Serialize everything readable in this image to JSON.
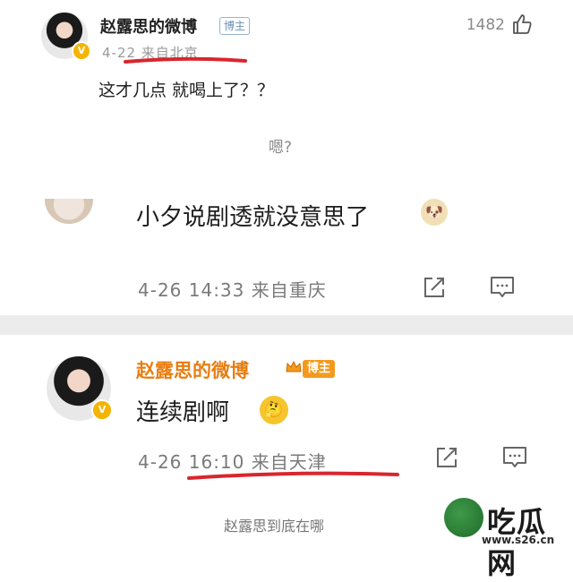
{
  "post1": {
    "author": "赵露思的微博",
    "author_tag": "博主",
    "meta": "4-22  来自北京",
    "like_count": "1482",
    "text": "这才几点 就喝上了？？"
  },
  "hmm_text": "嗯?",
  "post2": {
    "text": "小夕说剧透就没意思了",
    "meta": "4-26 14:33 来自重庆"
  },
  "post3": {
    "author": "赵露思的微博",
    "author_tag": "博主",
    "text": "连续剧啊",
    "meta": "4-26 16:10 来自天津"
  },
  "footer_text": "赵露思到底在哪",
  "watermark": {
    "name": "吃瓜网",
    "url": "www.s26.cn"
  },
  "colors": {
    "underline": "#d9262e",
    "gold_name": "#e87d10",
    "tag_orange": "#f39a1e"
  },
  "icons": [
    "thumbs-up-icon",
    "share-icon",
    "comment-icon",
    "verified-v-icon",
    "crown-icon",
    "dog-emoji-icon",
    "thinking-emoji-icon"
  ]
}
